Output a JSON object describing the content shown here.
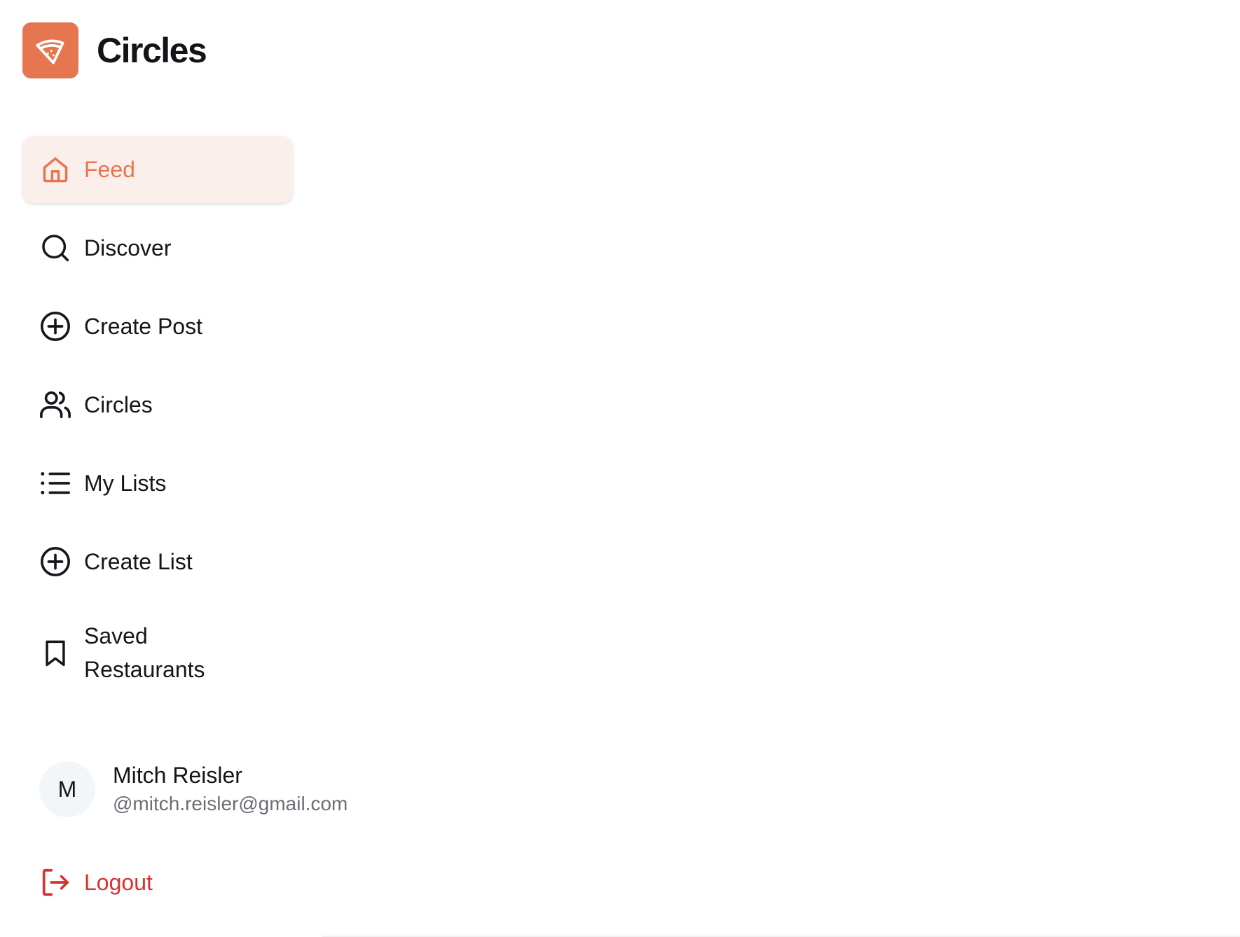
{
  "brand": {
    "name": "Circles",
    "logo_icon": "pizza-slice-icon",
    "logo_color": "#e57650"
  },
  "nav": {
    "items": [
      {
        "label": "Feed",
        "icon": "home-icon",
        "active": true
      },
      {
        "label": "Discover",
        "icon": "search-icon",
        "active": false
      },
      {
        "label": "Create Post",
        "icon": "plus-circle-icon",
        "active": false
      },
      {
        "label": "Circles",
        "icon": "users-icon",
        "active": false
      },
      {
        "label": "My Lists",
        "icon": "list-icon",
        "active": false
      },
      {
        "label": "Create List",
        "icon": "plus-circle-icon",
        "active": false
      },
      {
        "label": "Saved Restaurants",
        "icon": "bookmark-icon",
        "active": false
      }
    ],
    "active_color": "#e57650",
    "active_background": "#fbefec"
  },
  "user": {
    "initial": "M",
    "name": "Mitch Reisler",
    "email": "@mitch.reisler@gmail.com"
  },
  "logout": {
    "label": "Logout",
    "icon": "logout-icon",
    "color": "#dc2f2f"
  }
}
